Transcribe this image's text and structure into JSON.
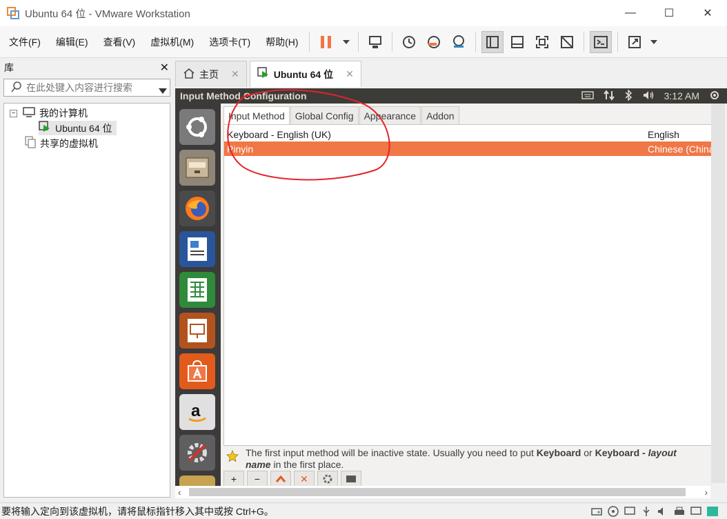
{
  "window": {
    "title": "Ubuntu 64 位 - VMware Workstation"
  },
  "menu": [
    "文件(F)",
    "编辑(E)",
    "查看(V)",
    "虚拟机(M)",
    "选项卡(T)",
    "帮助(H)"
  ],
  "library": {
    "title": "库",
    "search_placeholder": "在此处键入内容进行搜索",
    "tree": {
      "my_computer": "我的计算机",
      "vm": "Ubuntu 64 位",
      "shared": "共享的虚拟机"
    }
  },
  "tabs": {
    "home": "主页",
    "vm": "Ubuntu 64 位"
  },
  "ubuntu": {
    "window_title": "Input Method Configuration",
    "clock": "3:12 AM"
  },
  "config": {
    "tabs": [
      "Input Method",
      "Global Config",
      "Appearance",
      "Addon"
    ],
    "rows": [
      {
        "name": "Keyboard - English (UK)",
        "lang": "English"
      },
      {
        "name": "Pinyin",
        "lang": "Chinese (China)"
      }
    ],
    "hint_line1_a": "The first input method will be inactive state. Usually you need to put ",
    "hint_line1_b": "Keyboard",
    "hint_line1_c": " or ",
    "hint_line1_d": "Keyboard - ",
    "hint_line1_e": "layout",
    "hint_line2_a": "name",
    "hint_line2_b": " in the first place."
  },
  "status": {
    "text": "要将输入定向到该虚拟机，请将鼠标指针移入其中或按 Ctrl+G。"
  },
  "colors": {
    "selection": "#f07746",
    "pause": "#f07746",
    "annotation": "#e3242b"
  }
}
